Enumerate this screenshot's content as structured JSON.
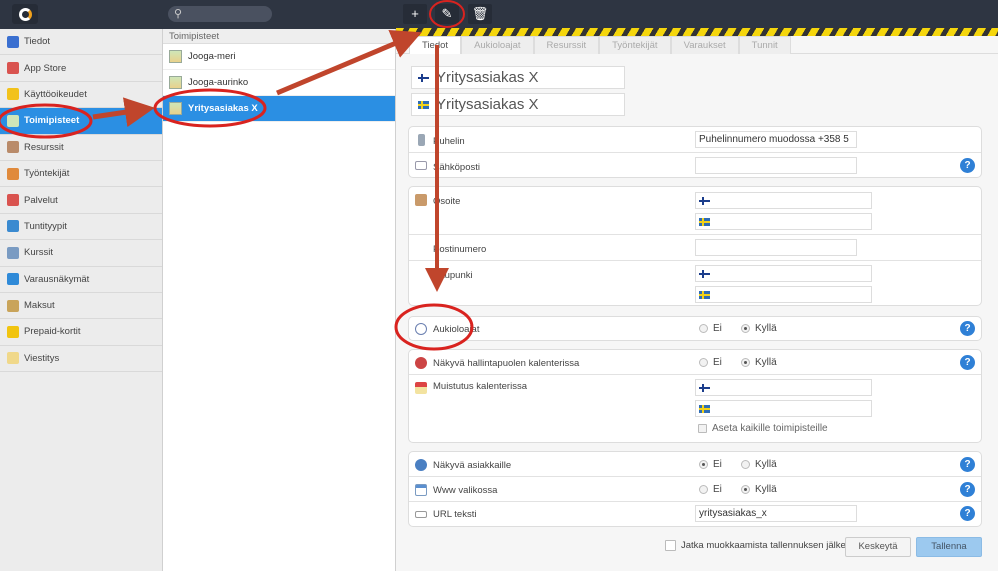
{
  "toolbar": {
    "search_placeholder": "",
    "add_icon": "plus-icon",
    "edit_icon": "pencil-icon",
    "delete_icon": "trash-icon"
  },
  "sidebar": {
    "items": [
      {
        "label": "Tiedot",
        "icon": "info-icon",
        "color": "#3a6fd0"
      },
      {
        "label": "App Store",
        "icon": "store-icon",
        "color": "#d9534f"
      },
      {
        "label": "Käyttöoikeudet",
        "icon": "star-icon",
        "color": "#f2c21b"
      },
      {
        "label": "Toimipisteet",
        "icon": "location-image-icon",
        "color": "#cfe6b8",
        "selected": true
      },
      {
        "label": "Resurssit",
        "icon": "house-icon",
        "color": "#b98b6a"
      },
      {
        "label": "Työntekijät",
        "icon": "people-icon",
        "color": "#e08a3c"
      },
      {
        "label": "Palvelut",
        "icon": "calendar-icon",
        "color": "#d9534f"
      },
      {
        "label": "Tuntityypit",
        "icon": "calendar-blue-icon",
        "color": "#3a8ad0"
      },
      {
        "label": "Kurssit",
        "icon": "course-icon",
        "color": "#7a9bc2"
      },
      {
        "label": "Varausnäkymät",
        "icon": "globe-icon",
        "color": "#2f8ad8"
      },
      {
        "label": "Maksut",
        "icon": "lock-icon",
        "color": "#c9a45a"
      },
      {
        "label": "Prepaid-kortit",
        "icon": "card-icon",
        "color": "#f1c40f"
      },
      {
        "label": "Viestitys",
        "icon": "chat-icon",
        "color": "#f0d88a"
      }
    ]
  },
  "list": {
    "header": "Toimipisteet",
    "items": [
      {
        "label": "Jooga-meri"
      },
      {
        "label": "Jooga-aurinko"
      },
      {
        "label": "Yritysasiakas X",
        "selected": true
      }
    ]
  },
  "tabs": [
    {
      "label": "Tiedot",
      "active": true
    },
    {
      "label": "Aukioloajat"
    },
    {
      "label": "Resurssit"
    },
    {
      "label": "Työntekijät"
    },
    {
      "label": "Varaukset"
    },
    {
      "label": "Tunnit"
    }
  ],
  "form": {
    "name_fi": "Yritysasiakas X",
    "name_sv": "Yritysasiakas X",
    "phone_label": "Puhelin",
    "phone_value": "Puhelinnumero muodossa +358 5",
    "email_label": "Sähköposti",
    "email_value": "",
    "address_label": "Osoite",
    "postal_label": "Postinumero",
    "city_label": "Kaupunki",
    "opening_label": "Aukioloajat",
    "admin_cal_label": "Näkyvä hallintapuolen kalenterissa",
    "reminder_label": "Muistutus kalenterissa",
    "set_all_label": "Aseta kaikille toimipisteille",
    "visible_customers_label": "Näkyvä asiakkaille",
    "www_label": "Www valikossa",
    "url_label": "URL teksti",
    "url_value": "yritysasiakas_x",
    "no": "Ei",
    "yes": "Kyllä",
    "radios": {
      "opening": "Kyllä",
      "admin_cal": "Kyllä",
      "visible_customers": "Ei",
      "www": "Kyllä"
    },
    "help": "?"
  },
  "footer": {
    "continue_label": "Jatka muokkaamista tallennuksen jälkeen",
    "cancel": "Keskeytä",
    "save": "Tallenna"
  },
  "colors": {
    "accent": "#2b8fe3",
    "topbar": "#2e3542",
    "annotation": "#d9231f",
    "arrow": "#c0452c"
  }
}
